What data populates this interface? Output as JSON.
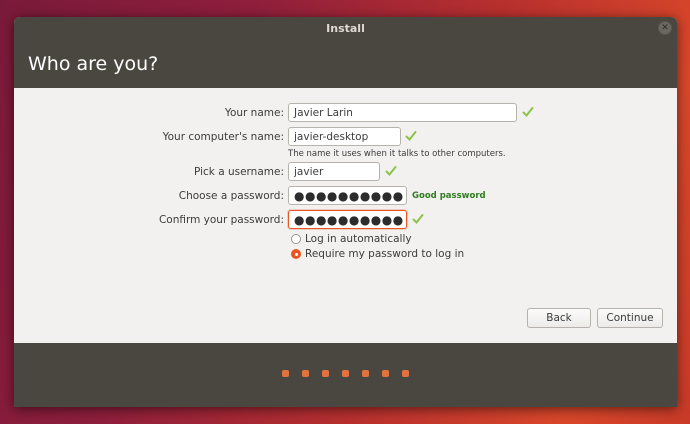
{
  "window": {
    "title": "Install"
  },
  "header": {
    "title": "Who are you?"
  },
  "form": {
    "name_label": "Your name:",
    "name_value": "Javier Larin",
    "computer_label": "Your computer's name:",
    "computer_value": "javier-desktop",
    "computer_hint": "The name it uses when it talks to other computers.",
    "username_label": "Pick a username:",
    "username_value": "javier",
    "password_label": "Choose a password:",
    "password_value": "●●●●●●●●●●",
    "password_strength": "Good password",
    "confirm_label": "Confirm your password:",
    "confirm_value": "●●●●●●●●●●"
  },
  "options": {
    "auto_login": "Log in automatically",
    "require_password": "Require my password to log in",
    "selected": "require_password"
  },
  "buttons": {
    "back": "Back",
    "continue": "Continue"
  },
  "progress": {
    "steps": 7
  },
  "colors": {
    "accent": "#e95420",
    "header_bg": "#4a4741",
    "strength_good": "#2f7d1f",
    "check": "#8bc34a"
  },
  "icons": {
    "valid": "checkmark-icon",
    "close": "close-icon"
  }
}
